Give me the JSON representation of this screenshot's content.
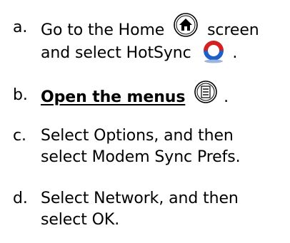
{
  "steps": [
    {
      "marker": "a.",
      "line1_before": "Go to the Home",
      "line1_after": "screen",
      "line2_before": "and select HotSync",
      "line2_after": ".",
      "icons": [
        "home-icon",
        "hotsync-icon"
      ]
    },
    {
      "marker": "b.",
      "link_text": "Open the menus",
      "after": ".",
      "icons": [
        "menu-icon"
      ]
    },
    {
      "marker": "c.",
      "line1": "Select Options, and then",
      "line2": "select Modem Sync Prefs."
    },
    {
      "marker": "d.",
      "line1": "Select Network, and then",
      "line2": "select OK."
    }
  ],
  "colors": {
    "text": "#000000",
    "hotsync_red": "#d62020",
    "hotsync_blue": "#1f5fc8"
  }
}
